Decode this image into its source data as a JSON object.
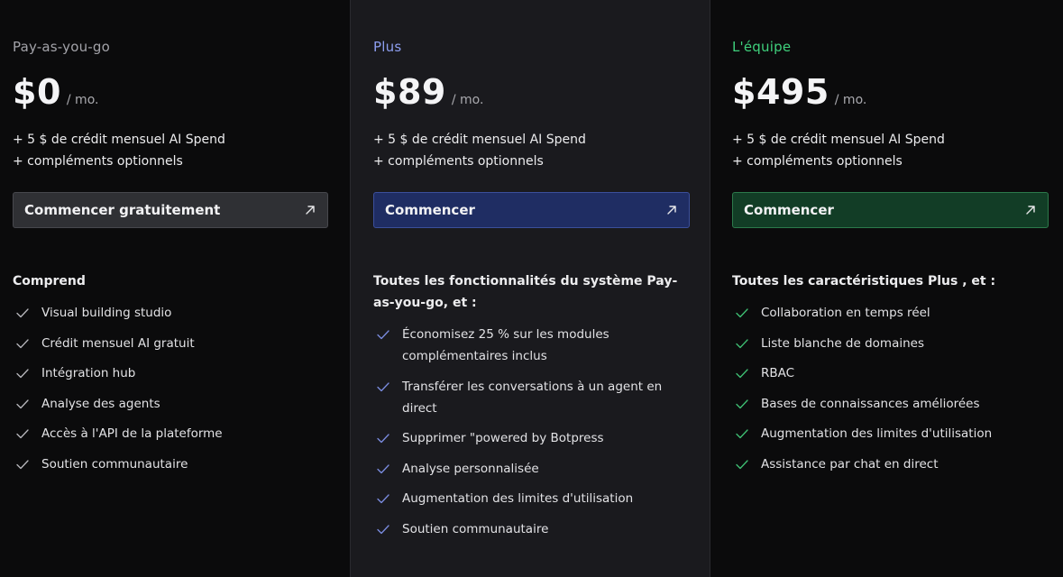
{
  "plans": [
    {
      "name": "Pay-as-you-go",
      "price": "$0",
      "period": "/ mo.",
      "credit_line1": "+ 5 $ de crédit mensuel AI Spend",
      "credit_line2": "+ compléments optionnels",
      "cta_label": "Commencer gratuitement",
      "includes_title": "Comprend",
      "features": [
        "Visual building studio",
        "Crédit mensuel AI gratuit",
        "Intégration hub",
        "Analyse des agents",
        "Accès à l'API de la plateforme",
        "Soutien communautaire"
      ]
    },
    {
      "name": "Plus",
      "price": "$89",
      "period": "/ mo.",
      "credit_line1": "+ 5 $ de crédit mensuel AI Spend",
      "credit_line2": "+ compléments optionnels",
      "cta_label": "Commencer",
      "includes_title": "Toutes les fonctionnalités du système Pay-as-you-go, et :",
      "features": [
        "Économisez 25 % sur les modules complémentaires inclus",
        "Transférer les conversations à un agent en direct",
        "Supprimer \"powered by Botpress",
        "Analyse personnalisée",
        "Augmentation des limites d'utilisation",
        "Soutien communautaire"
      ]
    },
    {
      "name": "L'équipe",
      "price": "$495",
      "period": "/ mo.",
      "credit_line1": "+ 5 $ de crédit mensuel AI Spend",
      "credit_line2": "+ compléments optionnels",
      "cta_label": "Commencer",
      "includes_title": "Toutes les caractéristiques Plus , et :",
      "features": [
        "Collaboration en temps réel",
        "Liste blanche de domaines",
        "RBAC",
        "Bases de connaissances améliorées",
        "Augmentation des limites d'utilisation",
        "Assistance par chat en direct"
      ]
    }
  ],
  "icons": {
    "cta": "arrow-up-right-icon",
    "feature": "check-icon"
  },
  "colors": {
    "background": "#0b0b0c",
    "highlight_column": "#1a1a1e",
    "plus_accent": "#8d9ef0",
    "team_accent": "#3fd07c",
    "plus_button": "#1f2d63",
    "team_button": "#123d26",
    "free_button": "#2f3034"
  }
}
